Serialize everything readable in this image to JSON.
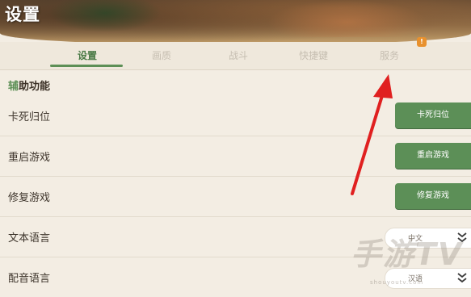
{
  "header": {
    "title": "设置"
  },
  "tabs": [
    {
      "label": "设置",
      "active": true
    },
    {
      "label": "画质",
      "active": false
    },
    {
      "label": "战斗",
      "active": false
    },
    {
      "label": "快捷键",
      "active": false
    },
    {
      "label": "服务",
      "active": false
    }
  ],
  "tab_badge": "!",
  "section": {
    "title_highlight": "辅",
    "title_rest": "助功能"
  },
  "rows": [
    {
      "label": "卡死归位",
      "button": "卡死归位"
    },
    {
      "label": "重启游戏",
      "button": "重启游戏"
    },
    {
      "label": "修复游戏",
      "button": "修复游戏"
    },
    {
      "label": "文本语言",
      "value": "中文"
    },
    {
      "label": "配音语言",
      "value": "汉语"
    }
  ],
  "watermark": {
    "main": "手游TV",
    "sub": "shouyoutv.com"
  },
  "colors": {
    "accent": "#5c8f57",
    "arrow": "#e02020",
    "badge": "#e8912e"
  }
}
